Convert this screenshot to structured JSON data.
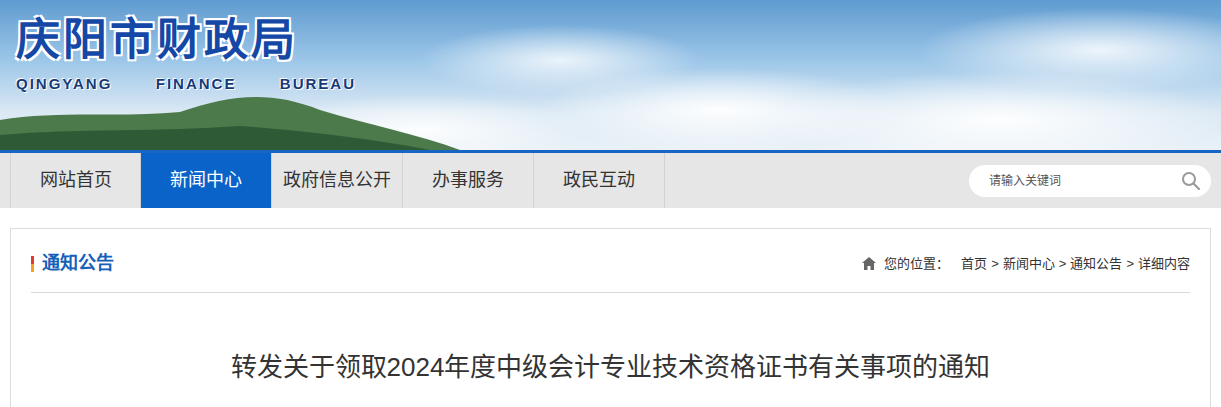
{
  "header": {
    "title": "庆阳市财政局",
    "subtitle": [
      "QINGYANG",
      "FINANCE",
      "BUREAU"
    ]
  },
  "nav": [
    {
      "label": "网站首页",
      "selected": false
    },
    {
      "label": "新闻中心",
      "selected": true
    },
    {
      "label": "政府信息公开",
      "selected": false
    },
    {
      "label": "办事服务",
      "selected": false
    },
    {
      "label": "政民互动",
      "selected": false
    }
  ],
  "search": {
    "placeholder": "请输入关键词"
  },
  "section": {
    "title": "通知公告"
  },
  "breadcrumb": {
    "label": "您的位置：",
    "separator": ">",
    "items": [
      "首页",
      "新闻中心",
      "通知公告",
      "详细内容"
    ]
  },
  "article": {
    "title": "转发关于领取2024年度中级会计专业技术资格证书有关事项的通知"
  }
}
